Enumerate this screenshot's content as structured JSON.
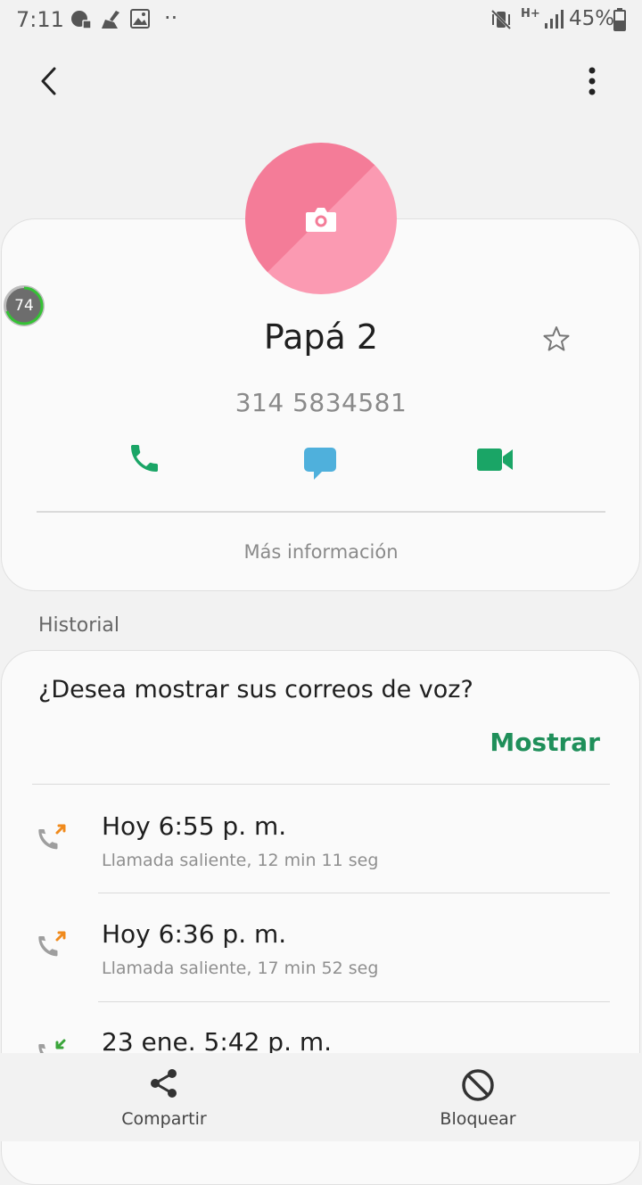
{
  "status_bar": {
    "time": "7:11",
    "battery": "45%",
    "dots": "··",
    "network": "H+"
  },
  "contact": {
    "name": "Papá 2",
    "number": "314 5834581",
    "badge": "74",
    "more_info": "Más información"
  },
  "history": {
    "label": "Historial",
    "voicemail_question": "¿Desea mostrar sus correos de voz?",
    "voicemail_action": "Mostrar",
    "rows": [
      {
        "title": "Hoy 6:55 p. m.",
        "subtitle": "Llamada saliente, 12 min 11 seg",
        "type": "outgoing"
      },
      {
        "title": "Hoy 6:36 p. m.",
        "subtitle": "Llamada saliente, 17 min 52 seg",
        "type": "outgoing"
      },
      {
        "title": "23 ene. 5:42 p. m.",
        "subtitle": "",
        "type": "incoming"
      }
    ]
  },
  "bottom_bar": {
    "share": "Compartir",
    "block": "Bloquear"
  },
  "colors": {
    "call_green": "#1aa566",
    "message_blue": "#4fb0dc",
    "avatar_pink": "#f47c98",
    "accent_green": "#1f8f5a",
    "outgoing_orange": "#f08a1c",
    "incoming_green": "#3aa53a"
  }
}
